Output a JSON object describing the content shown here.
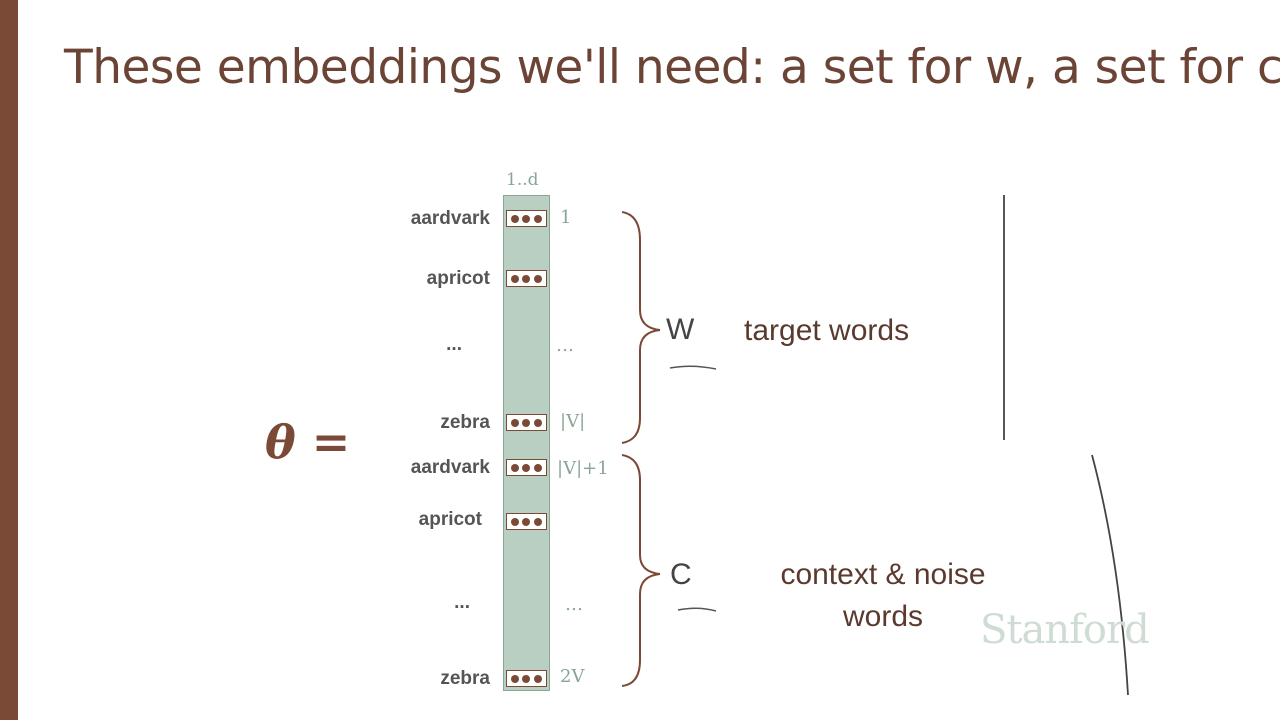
{
  "title": "These embeddings we'll need: a set for w, a set for c",
  "theta": "θ =",
  "column_header": "1..d",
  "rows": [
    {
      "word": "aardvark",
      "index": "1"
    },
    {
      "word": "apricot",
      "index": ""
    },
    {
      "word": "...",
      "index": "…"
    },
    {
      "word": "zebra",
      "index": "|V|"
    },
    {
      "word": "aardvark",
      "index": "|V|+1"
    },
    {
      "word": "apricot",
      "index": ""
    },
    {
      "word": "...",
      "index": "…"
    },
    {
      "word": "zebra",
      "index": "2V"
    }
  ],
  "groups": {
    "w": {
      "letter": "W",
      "label": "target words"
    },
    "c": {
      "letter": "C",
      "label_line1": "context & noise",
      "label_line2": "words"
    }
  },
  "watermark": "Stanford",
  "colors": {
    "accent": "#7b4a36",
    "column": "#b8cfc2",
    "index_text": "#8aa596"
  }
}
